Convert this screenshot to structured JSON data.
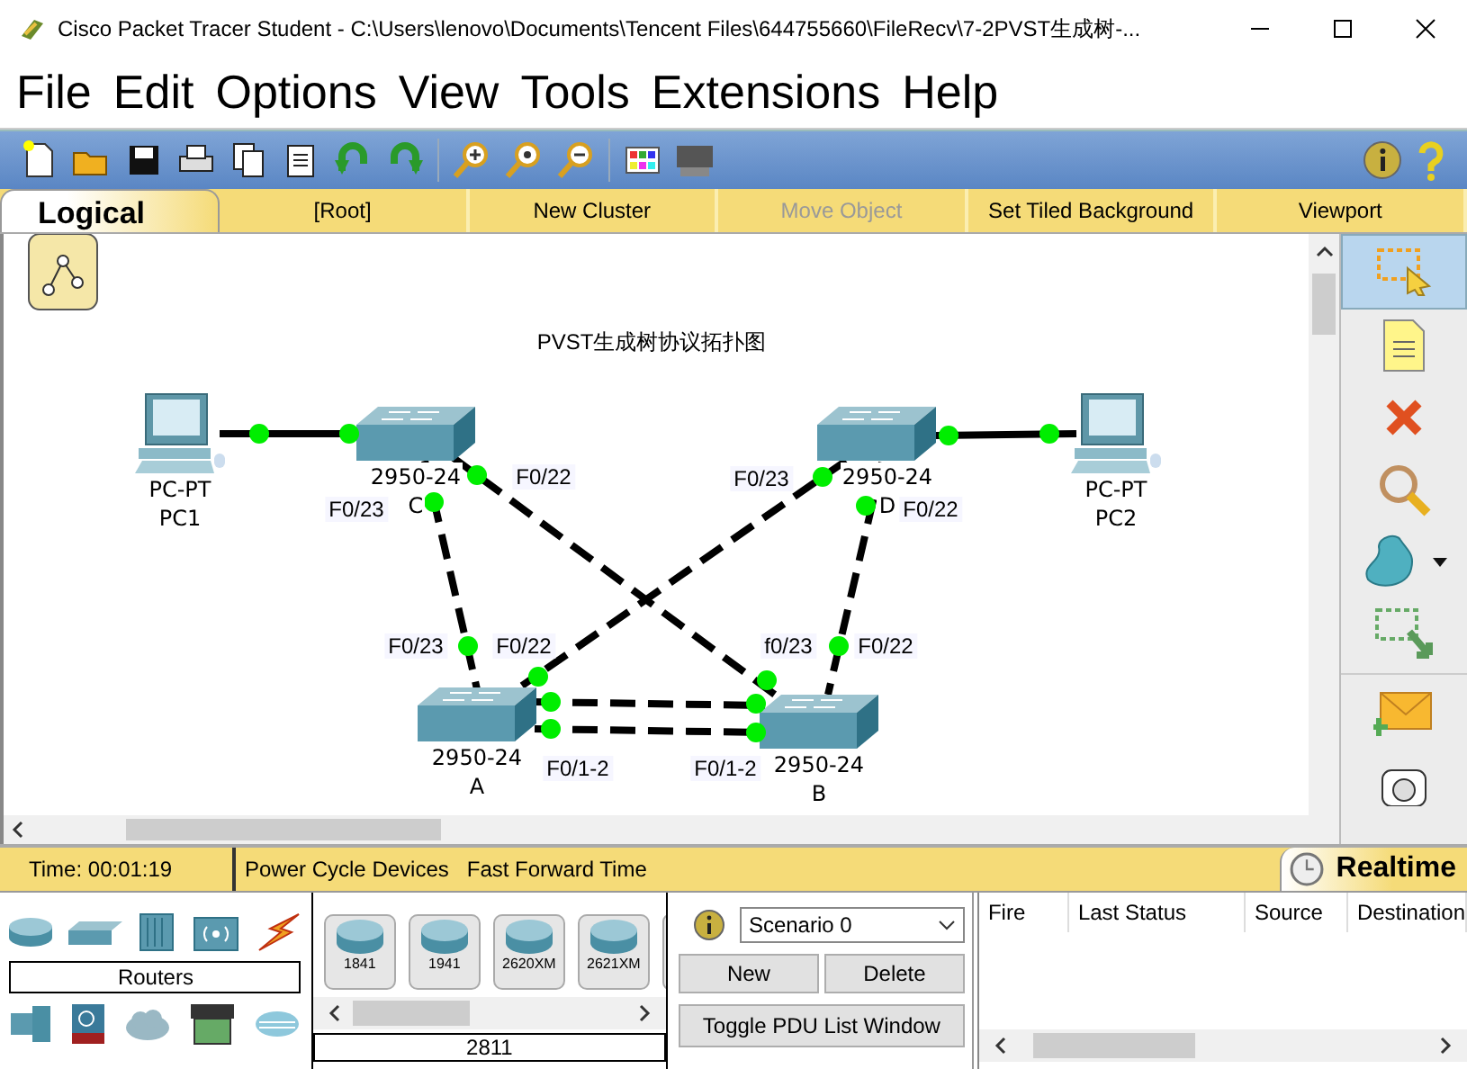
{
  "window": {
    "title": "Cisco Packet Tracer Student - C:\\Users\\lenovo\\Documents\\Tencent Files\\644755660\\FileRecv\\7-2PVST生成树-..."
  },
  "menu": [
    "File",
    "Edit",
    "Options",
    "View",
    "Tools",
    "Extensions",
    "Help"
  ],
  "workspace_bar": {
    "mode": "Logical",
    "items": [
      {
        "label": "[Root]",
        "disabled": false
      },
      {
        "label": "New Cluster",
        "disabled": false
      },
      {
        "label": "Move Object",
        "disabled": true
      },
      {
        "label": "Set Tiled Background",
        "disabled": false
      },
      {
        "label": "Viewport",
        "disabled": false
      }
    ]
  },
  "canvas": {
    "title": "PVST生成树协议拓扑图",
    "devices": [
      {
        "kind": "pc",
        "model": "PC-PT",
        "name": "PC1"
      },
      {
        "kind": "switch",
        "model": "2950-24",
        "name": "C"
      },
      {
        "kind": "switch",
        "model": "2950-24",
        "name": "D"
      },
      {
        "kind": "pc",
        "model": "PC-PT",
        "name": "PC2"
      },
      {
        "kind": "switch",
        "model": "2950-24",
        "name": "A"
      },
      {
        "kind": "switch",
        "model": "2950-24",
        "name": "B"
      }
    ],
    "port_labels": [
      "F0/23",
      "F0/22",
      "F0/23",
      "F0/22",
      "F0/23",
      "F0/22",
      "f0/23",
      "F0/22",
      "F0/1-2",
      "F0/1-2"
    ]
  },
  "palette_tools": [
    {
      "kind": "select",
      "selected": true
    },
    {
      "kind": "note",
      "selected": false
    },
    {
      "kind": "delete",
      "selected": false
    },
    {
      "kind": "inspect",
      "selected": false
    },
    {
      "kind": "shape",
      "selected": false
    },
    {
      "kind": "resize",
      "selected": false
    },
    {
      "kind": "simple_pdu",
      "selected": false
    },
    {
      "kind": "complex_pdu",
      "selected": false
    }
  ],
  "status_bar": {
    "time": "Time: 00:01:19",
    "actions": [
      "Power Cycle Devices",
      "Fast Forward Time"
    ],
    "mode": "Realtime"
  },
  "device_panel": {
    "category": "Routers",
    "models": [
      "1841",
      "1941",
      "2620XM",
      "2621XM"
    ],
    "selected_model": "2811"
  },
  "scenario": {
    "value": "Scenario 0",
    "buttons": [
      "New",
      "Delete"
    ],
    "toggle": "Toggle PDU List Window"
  },
  "pdu_table": {
    "columns": [
      "Fire",
      "Last Status",
      "Source",
      "Destination"
    ]
  }
}
